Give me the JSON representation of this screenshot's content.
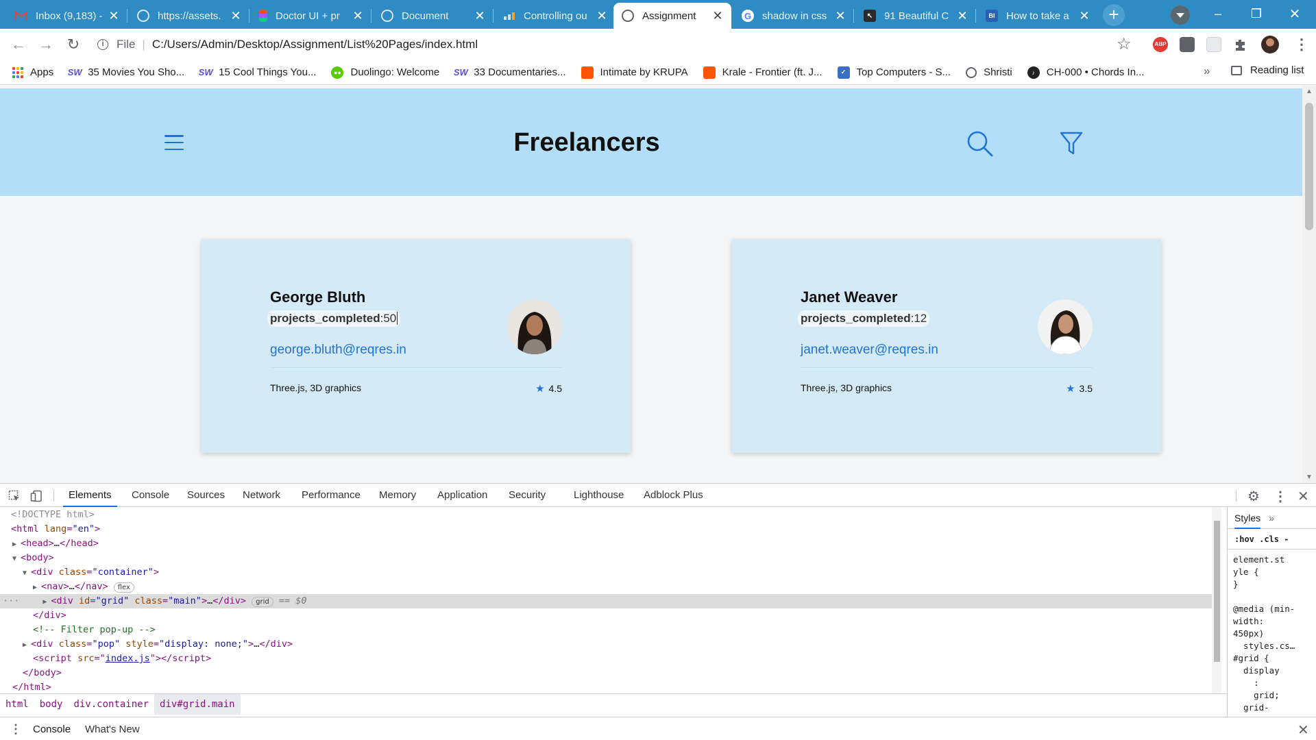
{
  "browser": {
    "tabs": [
      {
        "title": "Inbox (9,183) -",
        "icon": "gmail-icon",
        "color": "#ea4335",
        "active": false
      },
      {
        "title": "https://assets.",
        "icon": "globe-icon",
        "color": "#9aa0a6",
        "active": false
      },
      {
        "title": "Doctor UI + pr",
        "icon": "figma-icon",
        "color": "#f24e1e",
        "active": false
      },
      {
        "title": "Document",
        "icon": "globe-icon",
        "color": "#9aa0a6",
        "active": false
      },
      {
        "title": "Controlling ou",
        "icon": "chart-icon",
        "color": "#4fa0e0",
        "active": false
      },
      {
        "title": "Assignment",
        "icon": "globe-icon",
        "color": "#5f6368",
        "active": true
      },
      {
        "title": "shadow in css",
        "icon": "google-icon",
        "color": "#4285f4",
        "active": false
      },
      {
        "title": "91 Beautiful C",
        "icon": "cursor-icon",
        "color": "#333333",
        "active": false
      },
      {
        "title": "How to take a",
        "icon": "bi-icon",
        "color": "#2b5fb4",
        "active": false
      }
    ],
    "new_tab": "+",
    "window_controls": {
      "minimize": "–",
      "maximize": "❐",
      "close": "✕"
    },
    "address": {
      "scheme": "File",
      "url": "C:/Users/Admin/Desktop/Assignment/List%20Pages/index.html"
    },
    "bookmarks": [
      {
        "label": "Apps",
        "icon": "apps-grid-icon",
        "color": "#4285f4"
      },
      {
        "label": "35 Movies You Sho...",
        "icon": "sw-icon",
        "color": "#5a4fcf"
      },
      {
        "label": "15 Cool Things You...",
        "icon": "sw-icon",
        "color": "#5a4fcf"
      },
      {
        "label": "Duolingo: Welcome",
        "icon": "duolingo-icon",
        "color": "#58cc02"
      },
      {
        "label": "33 Documentaries...",
        "icon": "sw-icon",
        "color": "#5a4fcf"
      },
      {
        "label": "Intimate by KRUPA",
        "icon": "soundcloud-icon",
        "color": "#ff5500"
      },
      {
        "label": "Krale - Frontier (ft. J...",
        "icon": "soundcloud-icon",
        "color": "#ff5500"
      },
      {
        "label": "Top Computers - S...",
        "icon": "tc-icon",
        "color": "#3b6fc4"
      },
      {
        "label": "Shristi",
        "icon": "globe-icon",
        "color": "#5f6368"
      },
      {
        "label": "CH-000 • Chords In...",
        "icon": "chords-icon",
        "color": "#222222"
      }
    ],
    "bookmarks_more": "»",
    "reading_list": "Reading list"
  },
  "page": {
    "title": "Freelancers",
    "accent": "#1f74d6",
    "header_bg": "#b3def7",
    "cards": [
      {
        "name": "George Bluth",
        "projects_key": "projects_completed",
        "projects_value": "50",
        "email": "george.bluth@reqres.in",
        "skills": "Three.js, 3D graphics",
        "rating": "4.5",
        "avatar": "avatar-woman-dark-hair"
      },
      {
        "name": "Janet Weaver",
        "projects_key": "projects_completed",
        "projects_value": "12",
        "email": "janet.weaver@reqres.in",
        "skills": "Three.js, 3D graphics",
        "rating": "3.5",
        "avatar": "avatar-woman-white-jacket"
      }
    ]
  },
  "devtools": {
    "tabs": [
      "Elements",
      "Console",
      "Sources",
      "Network",
      "Performance",
      "Memory",
      "Application",
      "Security",
      "Lighthouse",
      "Adblock Plus"
    ],
    "active_tab": "Elements",
    "dom": {
      "doctype": "<!DOCTYPE html>",
      "html_open": "html",
      "html_attr": "lang",
      "html_attr_val": "\"en\"",
      "head": "head",
      "head_ellipsis": "…",
      "body": "body",
      "div": "div",
      "class_attr": "class",
      "container_val": "\"container\"",
      "nav": "nav",
      "flex_pill": "flex",
      "id_attr": "id",
      "grid_id_val": "\"grid\"",
      "main_val": "\"main\"",
      "grid_pill": "grid",
      "selected_marker": "== $0",
      "comment": "<!-- Filter pop-up -->",
      "pop_val": "\"pop\"",
      "style_attr": "style",
      "style_val": "\"display: none;\"",
      "script": "script",
      "src_attr": "src",
      "src_val": "index.js"
    },
    "styles": {
      "tab": "Styles",
      "more": "»",
      "filter": ":hov  .cls  -",
      "code": "element.st\nyle {\n}\n\n@media (min-\nwidth:\n450px)\n  styles.cs…\n#grid {\n  display\n    :\n    grid;\n  grid-"
    },
    "breadcrumb": [
      "html",
      "body",
      "div.container",
      "div#grid.main"
    ],
    "drawer_tabs": [
      "Console",
      "What's New"
    ]
  }
}
